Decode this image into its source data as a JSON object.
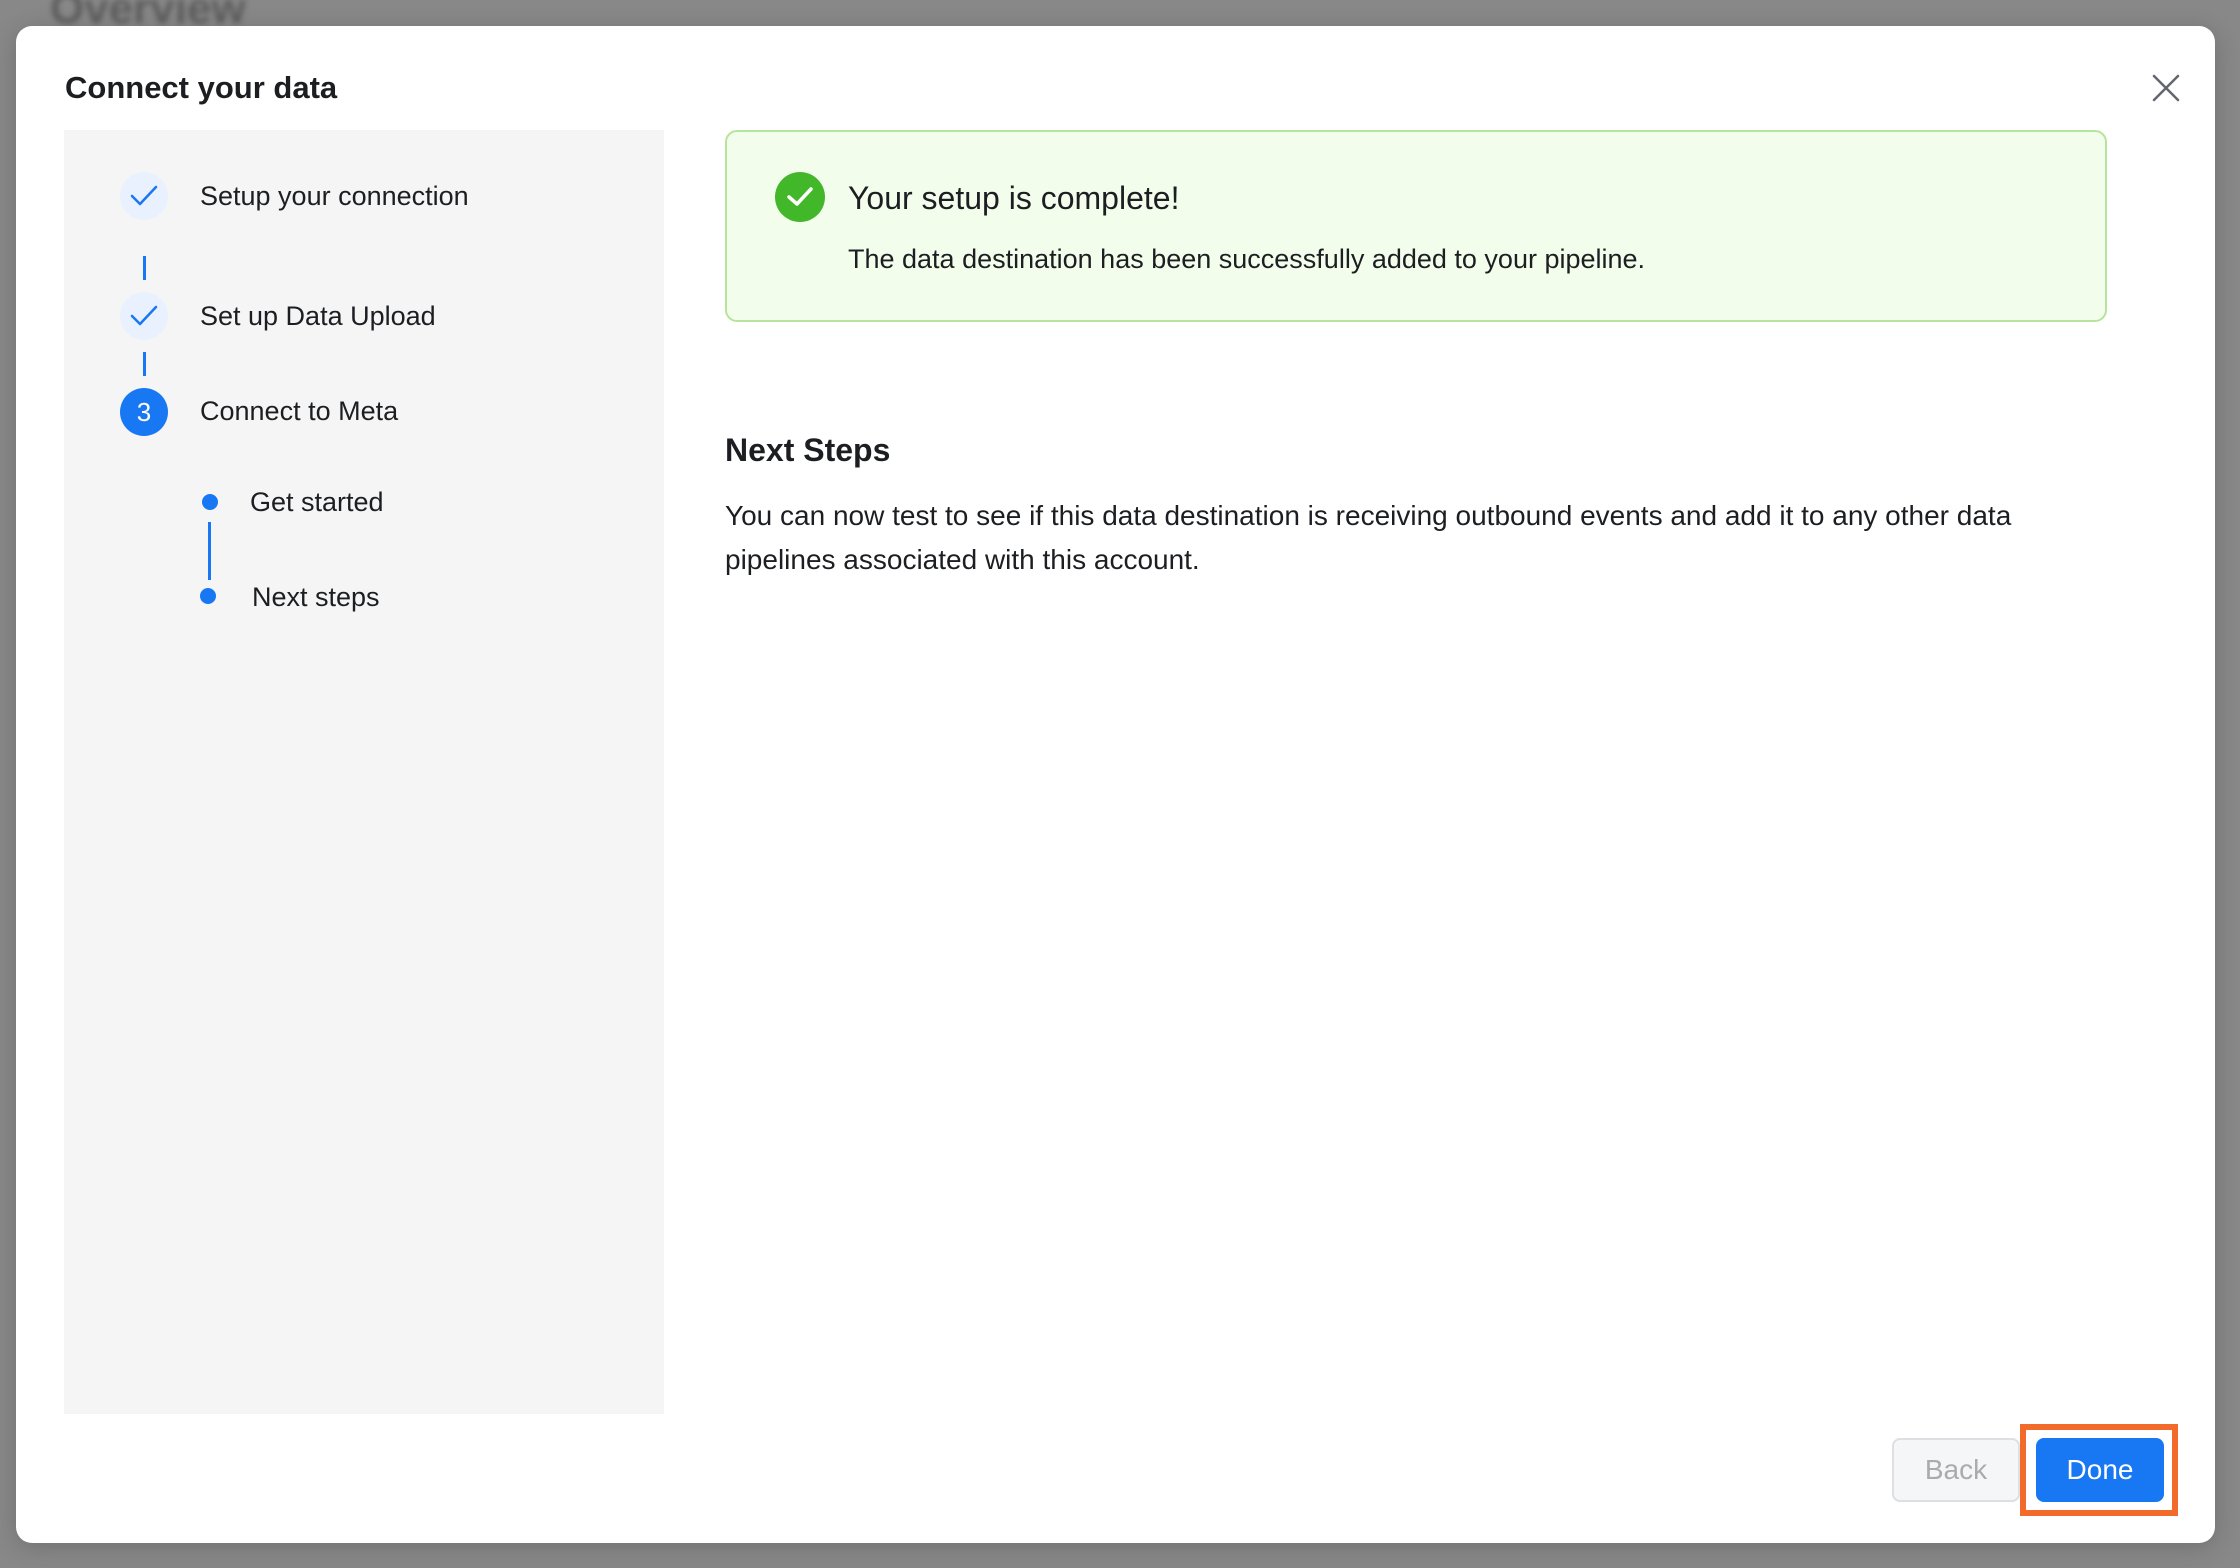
{
  "background": {
    "obscured_title": "Overview"
  },
  "modal": {
    "title": "Connect your data",
    "close_icon": "close-icon"
  },
  "steps": [
    {
      "label": "Setup your connection",
      "status": "complete",
      "icon": "check-icon"
    },
    {
      "label": "Set up Data Upload",
      "status": "complete",
      "icon": "check-icon"
    },
    {
      "label": "Connect to Meta",
      "status": "active",
      "number": "3"
    }
  ],
  "substeps": [
    {
      "label": "Get started"
    },
    {
      "label": "Next steps"
    }
  ],
  "success": {
    "icon": "check-circle-icon",
    "title": "Your setup is complete!",
    "description": "The data destination has been successfully added to your pipeline."
  },
  "next_steps": {
    "heading": "Next Steps",
    "body": "You can now test to see if this data destination is receiving outbound events and add it to any other data pipelines associated with this account."
  },
  "footer": {
    "back_label": "Back",
    "done_label": "Done"
  },
  "colors": {
    "accent": "#1877f2",
    "success": "#42b72a",
    "success_bg": "#f3fdec",
    "highlight": "#f26b2a"
  }
}
